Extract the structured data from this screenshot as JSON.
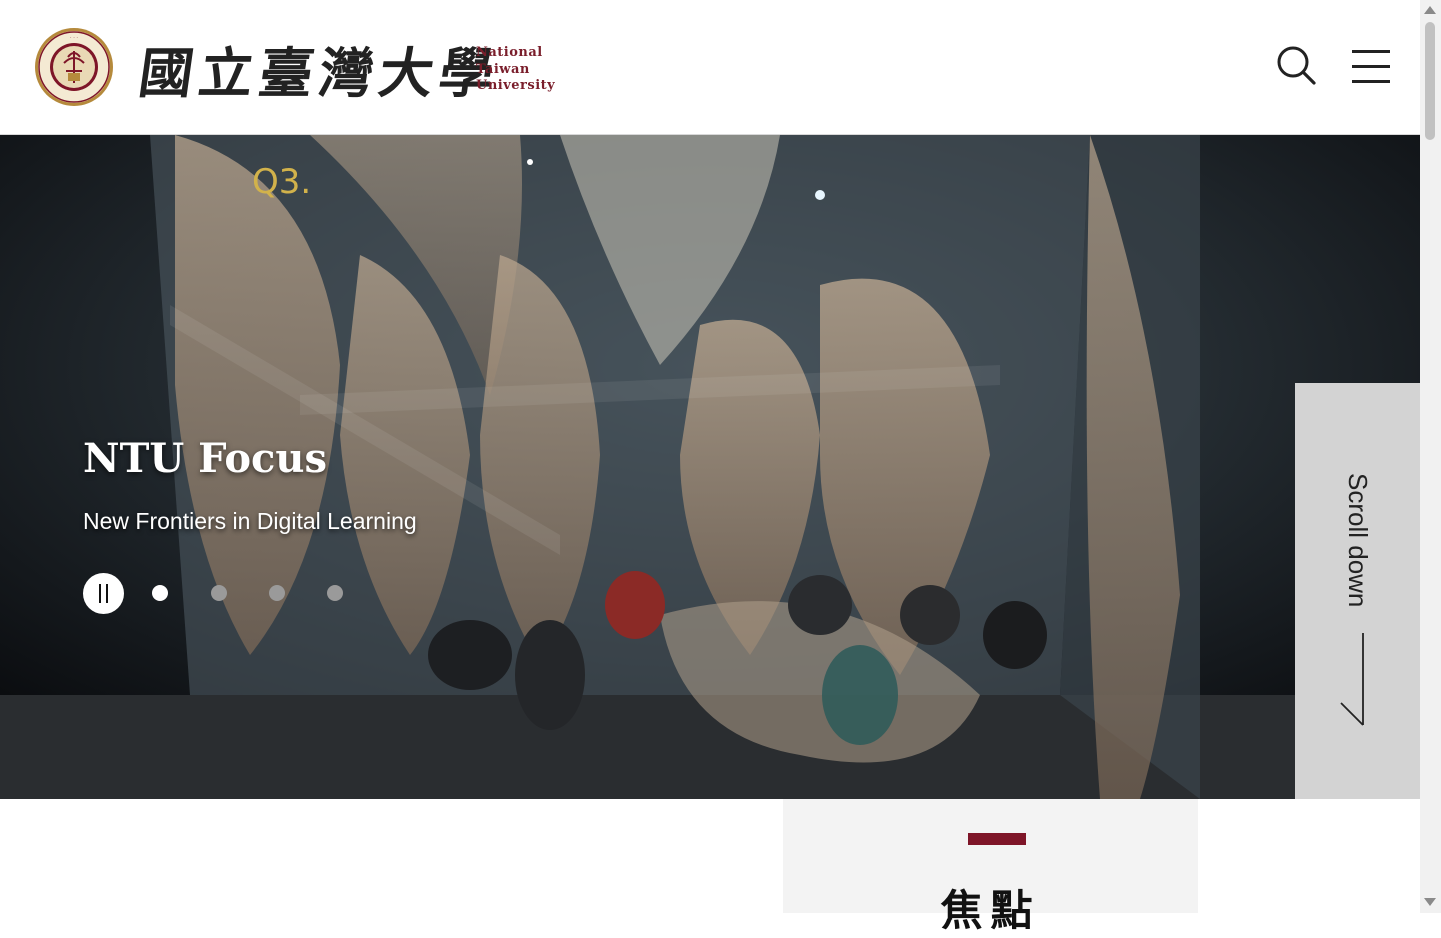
{
  "header": {
    "logo_chinese": [
      "國",
      "立",
      "臺",
      "灣",
      "大",
      "學"
    ],
    "logo_english": [
      "National",
      "Taiwan",
      "University"
    ],
    "search_icon": "search-icon",
    "menu_icon": "hamburger-menu-icon"
  },
  "hero": {
    "title": "NTU Focus",
    "subtitle": "New Frontiers in Digital Learning",
    "slide_count": 4,
    "active_slide": 1,
    "scroll_label": "Scroll down"
  },
  "focus_section": {
    "heading": "焦點"
  },
  "colors": {
    "brand": "#7e1528",
    "scroll_panel": "#d3d3d3"
  }
}
